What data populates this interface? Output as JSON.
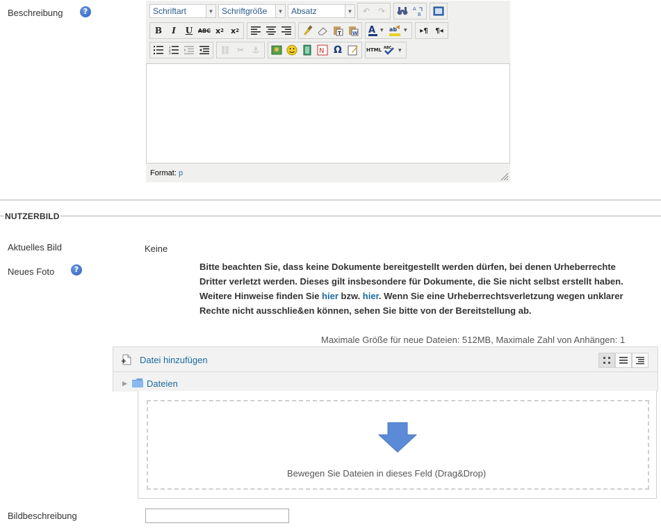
{
  "description": {
    "label": "Beschreibung",
    "help": "?",
    "editor": {
      "font_select": "Schriftart",
      "size_select": "Schriftgröße",
      "format_select": "Absatz",
      "status_label": "Format:",
      "status_value": "p"
    }
  },
  "section": {
    "title": "NUTZERBILD"
  },
  "current_image": {
    "label": "Aktuelles Bild",
    "value": "Keine"
  },
  "new_photo": {
    "label": "Neues Foto",
    "help": "?",
    "notice_part1": "Bitte beachten Sie, dass keine Dokumente bereitgestellt werden dürfen, bei denen Urheberrechte Dritter verletzt werden. Dieses gilt insbesondere für Dokumente, die Sie nicht selbst erstellt haben. Weitere Hinweise finden Sie ",
    "notice_link1": "hier",
    "notice_mid": " bzw. ",
    "notice_link2": "hier",
    "notice_part2": ". Wenn Sie eine Urheberrechtsverletzung wegen unklarer Rechte nicht ausschlie&en können, sehen Sie bitte von der Bereitstellung ab.",
    "max_info": "Maximale Größe für neue Dateien: 512MB, Maximale Zahl von Anhängen: 1",
    "add_file": "Datei hinzufügen",
    "folder": "Dateien",
    "drop_text": "Bewegen Sie Dateien in dieses Feld (Drag&Drop)"
  },
  "image_description": {
    "label": "Bildbeschreibung",
    "value": ""
  },
  "colors": {
    "link": "#1a6aa0",
    "drop_arrow": "#5b8ad6"
  }
}
